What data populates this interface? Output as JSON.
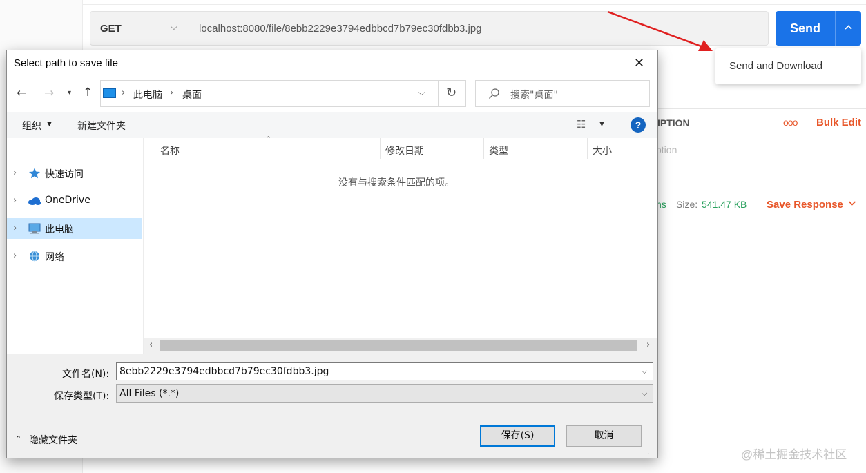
{
  "postman": {
    "method": "GET",
    "url": "localhost:8080/file/8ebb2229e3794edbbcd7b79ec30fdbb3.jpg",
    "send_label": "Send",
    "dropdown_item": "Send and Download",
    "params_desc_col": "IPTION",
    "params_more": "ooo",
    "bulk_edit": "Bulk Edit",
    "desc_placeholder": "otion",
    "time_fragment": "ns",
    "size_label": "Size:",
    "size_value": "541.47 KB",
    "save_response": "Save Response"
  },
  "watermark": "@稀土掘金技术社区",
  "dialog": {
    "title": "Select path to save file",
    "close": "✕",
    "address": {
      "crumbs": [
        "此电脑",
        "桌面"
      ],
      "separator": "›"
    },
    "search_placeholder": "搜索\"桌面\"",
    "toolbar": {
      "organize": "组织",
      "new_folder": "新建文件夹",
      "help": "?"
    },
    "nav_items": [
      {
        "label": "快速访问",
        "icon": "star-icon"
      },
      {
        "label": "OneDrive",
        "icon": "cloud-icon"
      },
      {
        "label": "此电脑",
        "icon": "computer-icon",
        "selected": true
      },
      {
        "label": "网络",
        "icon": "network-icon"
      }
    ],
    "columns": [
      "名称",
      "修改日期",
      "类型",
      "大小"
    ],
    "empty_message": "没有与搜索条件匹配的项。",
    "filename_label": "文件名(N):",
    "filename_value": "8ebb2229e3794edbbcd7b79ec30fdbb3.jpg",
    "filetype_label": "保存类型(T):",
    "filetype_value": "All Files (*.*)",
    "hide_folders": "隐藏文件夹",
    "save_button": "保存(S)",
    "cancel_button": "取消"
  },
  "colors": {
    "send_blue": "#1a73e8",
    "postman_orange": "#e8572a",
    "arrow_red": "#e02020",
    "selection": "#cce8ff"
  }
}
